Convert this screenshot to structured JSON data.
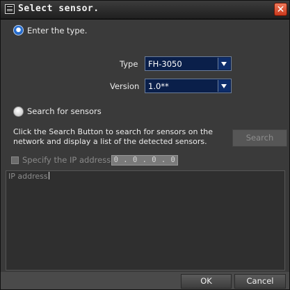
{
  "window": {
    "title": "Select sensor.",
    "title_icon": "app-icon",
    "close_icon": "close-icon",
    "close_glyph": "✕"
  },
  "enter_type": {
    "label": "Enter the type.",
    "selected": true,
    "type_label": "Type",
    "type_value": "FH-3050",
    "version_label": "Version",
    "version_value": "1.0**"
  },
  "search_sensors": {
    "label": "Search for sensors",
    "selected": false,
    "description": "Click the Search Button to search for sensors on the network and display a list of the detected sensors.",
    "search_button": "Search",
    "search_enabled": false,
    "specify_ip_label": "Specify the IP address.",
    "specify_ip_checked": false,
    "ip_value": "0 . 0 . 0 . 0"
  },
  "list": {
    "column_header": "IP address"
  },
  "footer": {
    "ok_label": "OK",
    "cancel_label": "Cancel"
  },
  "colors": {
    "accent": "#1b56b0",
    "close": "#c9381c"
  }
}
